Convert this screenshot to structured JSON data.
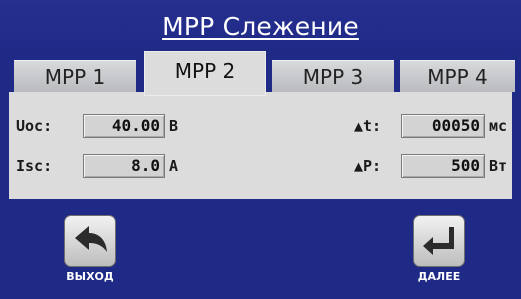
{
  "header": {
    "title": "MPP Слежение"
  },
  "tabs": [
    {
      "label": "MPP 1",
      "active": false
    },
    {
      "label": "MPP 2",
      "active": true
    },
    {
      "label": "MPP 3",
      "active": false
    },
    {
      "label": "MPP 4",
      "active": false
    }
  ],
  "params": {
    "uoc": {
      "label": "Uoc:",
      "value": "40.00",
      "unit": "В"
    },
    "isc": {
      "label": "Isc:",
      "value": "8.0",
      "unit": "А"
    },
    "dt": {
      "label": "▲t:",
      "value": "00050",
      "unit": "мс"
    },
    "dp": {
      "label": "▲P:",
      "value": "500",
      "unit": "Вт"
    }
  },
  "buttons": {
    "exit": {
      "label": "ВЫХОД",
      "icon": "back-arrow-icon"
    },
    "next": {
      "label": "ДАЛЕЕ",
      "icon": "enter-arrow-icon"
    }
  },
  "colors": {
    "background": "#1f2a87",
    "panel": "#dcdcdc",
    "tab_inactive": "#c8c9cb"
  }
}
